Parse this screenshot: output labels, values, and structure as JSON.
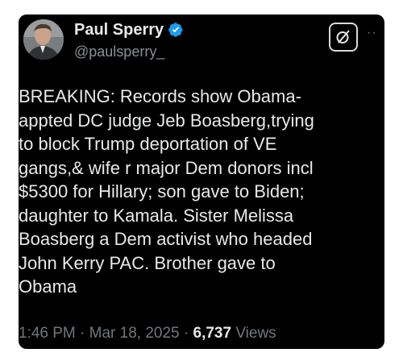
{
  "tweet": {
    "display_name": "Paul Sperry",
    "handle": "@paulsperry_",
    "text": "BREAKING: Records show Obama-\nappted DC judge Jeb Boasberg,trying\nto block Trump deportation of VE\ngangs,& wife r major Dem donors incl\n$5300 for Hillary; son gave to Biden;\ndaughter to Kamala. Sister Melissa\nBoasberg a Dem activist who headed\nJohn Kerry PAC. Brother gave to\nObama",
    "time": "1:46 PM",
    "separator": "·",
    "date": "Mar 18, 2025",
    "views_count": "6,737",
    "views_label": "Views"
  },
  "icons": {
    "verified": "verified-badge-icon",
    "grok": "grok-icon",
    "more": "more-options-icon"
  },
  "colors": {
    "background": "#000000",
    "text": "#e7e9ea",
    "secondary_text": "#71767b",
    "verified_blue": "#1d9bf0"
  }
}
